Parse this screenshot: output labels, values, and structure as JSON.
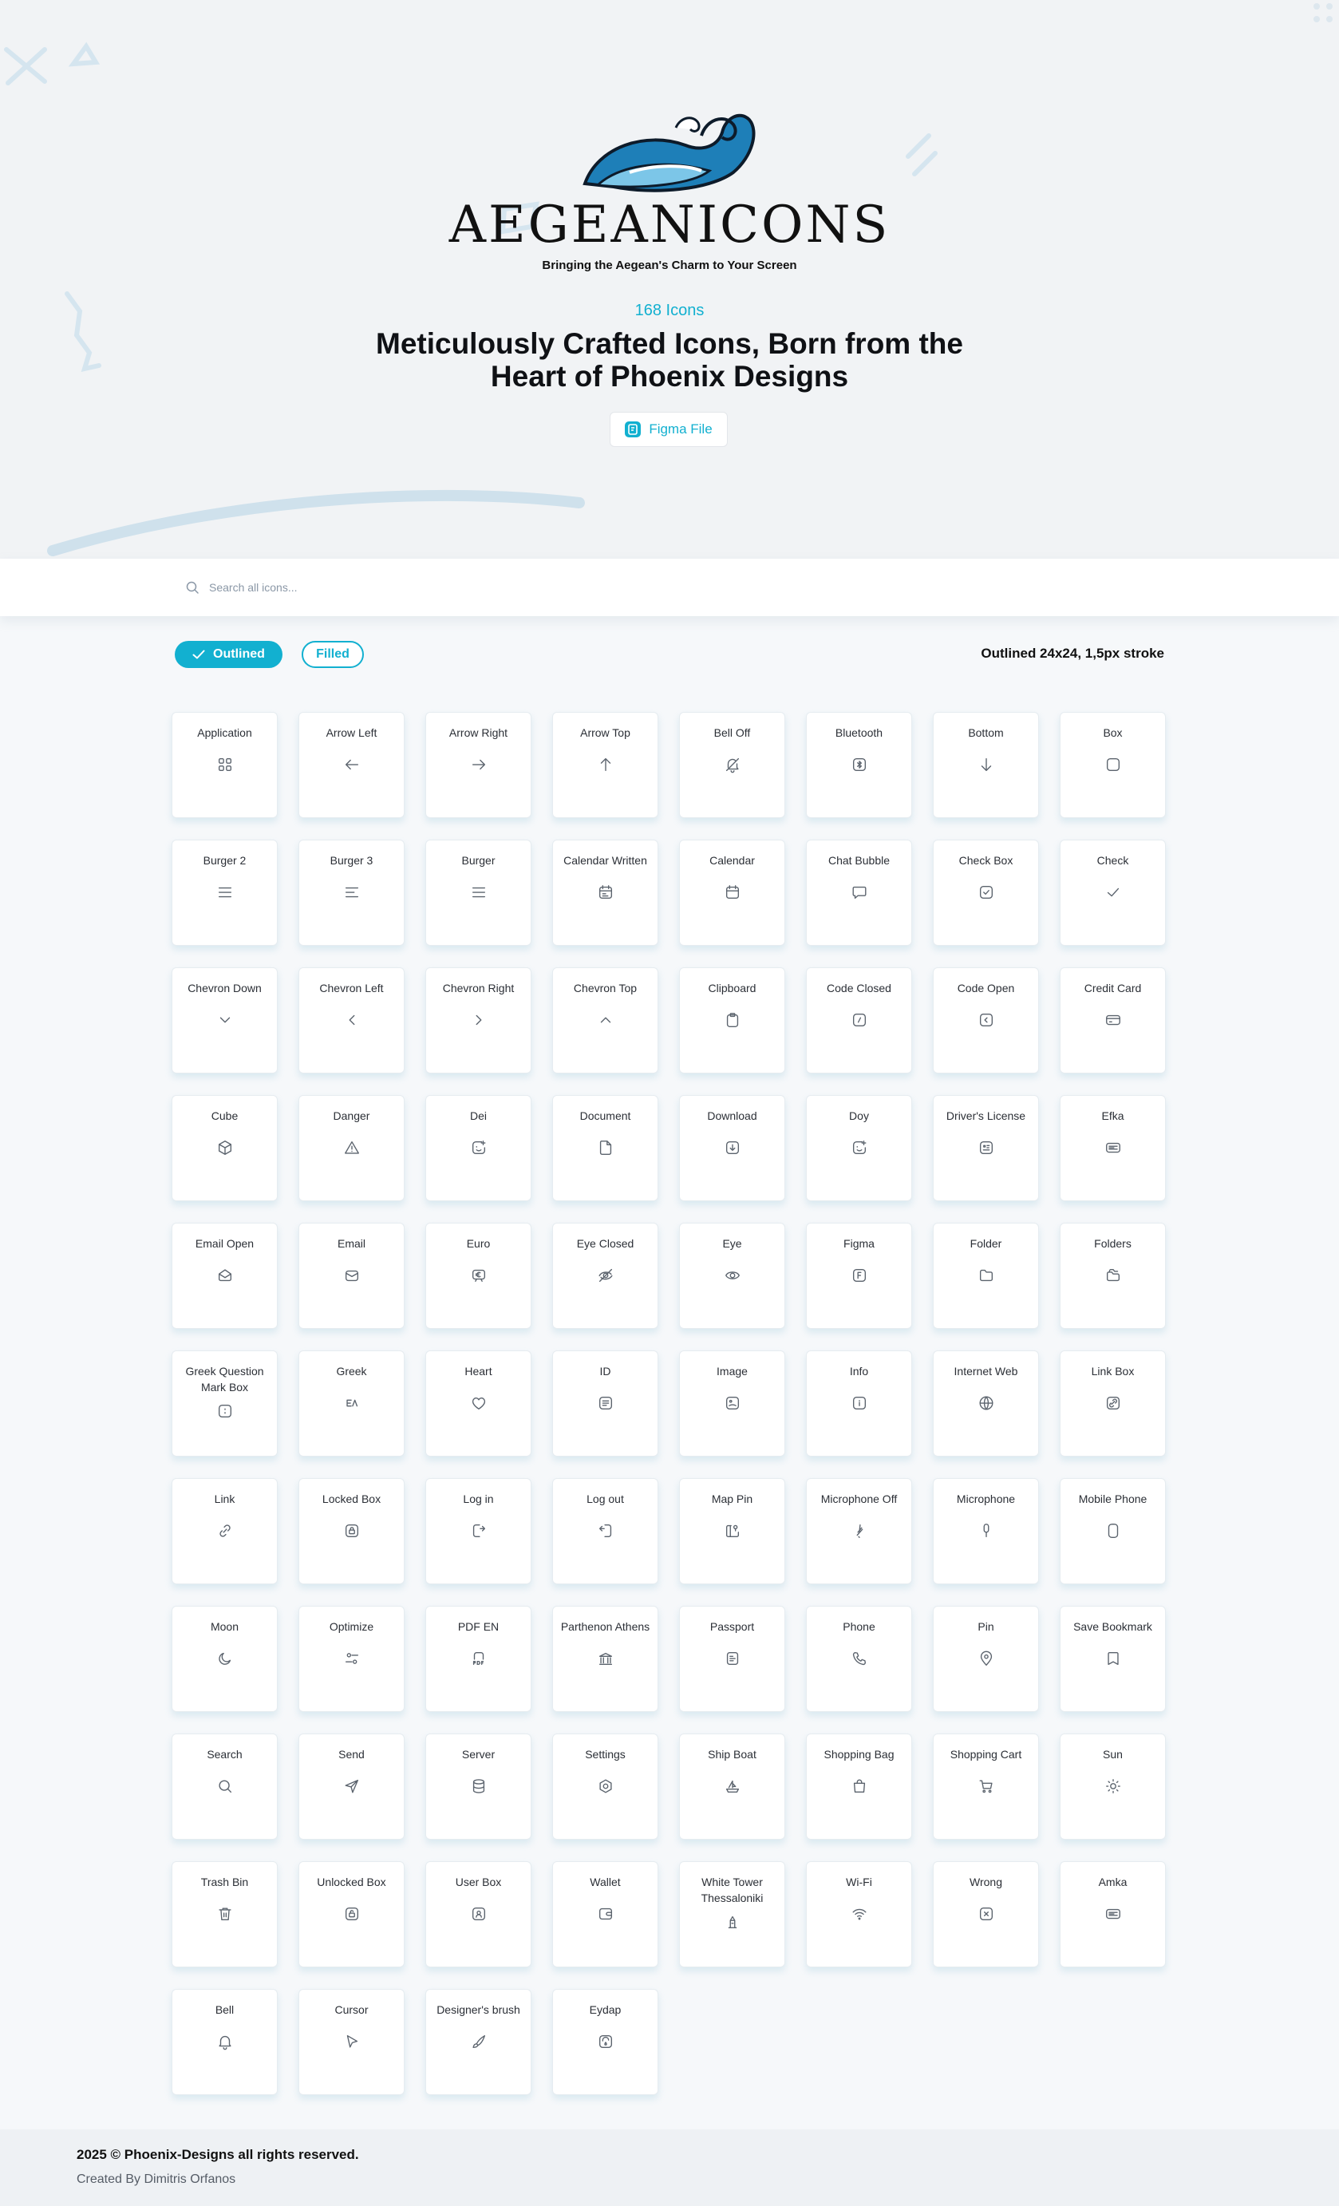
{
  "colors": {
    "accent": "#12b0d0",
    "text": "#111111",
    "background": "#f6f8fa"
  },
  "header": {
    "brand": "AEGEANICONS",
    "tagline": "Bringing the Aegean's Charm to Your Screen",
    "icon_count": "168 Icons",
    "headline_line1": "Meticulously Crafted Icons, Born from the",
    "headline_line2": "Heart of Phoenix Designs",
    "figma_button": "Figma File"
  },
  "search": {
    "placeholder": "Search all icons..."
  },
  "filters": {
    "outlined": "Outlined",
    "filled": "Filled",
    "active": "outlined",
    "spec": "Outlined 24x24, 1,5px stroke"
  },
  "icons": [
    {
      "name": "Application",
      "icon": "grid"
    },
    {
      "name": "Arrow Left",
      "icon": "arrow-left"
    },
    {
      "name": "Arrow Right",
      "icon": "arrow-right"
    },
    {
      "name": "Arrow Top",
      "icon": "arrow-up"
    },
    {
      "name": "Bell Off",
      "icon": "bell-off"
    },
    {
      "name": "Bluetooth",
      "icon": "bluetooth"
    },
    {
      "name": "Bottom",
      "icon": "arrow-down"
    },
    {
      "name": "Box",
      "icon": "box"
    },
    {
      "name": "Burger 2",
      "icon": "burger"
    },
    {
      "name": "Burger 3",
      "icon": "burger-short"
    },
    {
      "name": "Burger",
      "icon": "burger"
    },
    {
      "name": "Calendar Written",
      "icon": "calendar-written"
    },
    {
      "name": "Calendar",
      "icon": "calendar"
    },
    {
      "name": "Chat Bubble",
      "icon": "chat"
    },
    {
      "name": "Check Box",
      "icon": "checkbox"
    },
    {
      "name": "Check",
      "icon": "check"
    },
    {
      "name": "Chevron Down",
      "icon": "chevron-down"
    },
    {
      "name": "Chevron Left",
      "icon": "chevron-left"
    },
    {
      "name": "Chevron Right",
      "icon": "chevron-right"
    },
    {
      "name": "Chevron Top",
      "icon": "chevron-up"
    },
    {
      "name": "Clipboard",
      "icon": "clipboard"
    },
    {
      "name": "Code Closed",
      "icon": "code-closed"
    },
    {
      "name": "Code Open",
      "icon": "code-open"
    },
    {
      "name": "Credit Card",
      "icon": "credit-card"
    },
    {
      "name": "Cube",
      "icon": "cube"
    },
    {
      "name": "Danger",
      "icon": "danger"
    },
    {
      "name": "Dei",
      "icon": "face-plus"
    },
    {
      "name": "Document",
      "icon": "document"
    },
    {
      "name": "Download",
      "icon": "download"
    },
    {
      "name": "Doy",
      "icon": "face-plus"
    },
    {
      "name": "Driver's License",
      "icon": "license"
    },
    {
      "name": "Efka",
      "icon": "card-text"
    },
    {
      "name": "Email Open",
      "icon": "email-open"
    },
    {
      "name": "Email",
      "icon": "email"
    },
    {
      "name": "Euro",
      "icon": "euro"
    },
    {
      "name": "Eye Closed",
      "icon": "eye-closed"
    },
    {
      "name": "Eye",
      "icon": "eye"
    },
    {
      "name": "Figma",
      "icon": "figma"
    },
    {
      "name": "Folder",
      "icon": "folder"
    },
    {
      "name": "Folders",
      "icon": "folders"
    },
    {
      "name": "Greek Question Mark Box",
      "icon": "qmark-box"
    },
    {
      "name": "Greek",
      "icon": "greek"
    },
    {
      "name": "Heart",
      "icon": "heart"
    },
    {
      "name": "ID",
      "icon": "id"
    },
    {
      "name": "Image",
      "icon": "image"
    },
    {
      "name": "Info",
      "icon": "info"
    },
    {
      "name": "Internet Web",
      "icon": "globe"
    },
    {
      "name": "Link Box",
      "icon": "link-box"
    },
    {
      "name": "Link",
      "icon": "link"
    },
    {
      "name": "Locked Box",
      "icon": "locked-box"
    },
    {
      "name": "Log in",
      "icon": "log-in"
    },
    {
      "name": "Log out",
      "icon": "log-out"
    },
    {
      "name": "Map Pin",
      "icon": "map-pin"
    },
    {
      "name": "Microphone Off",
      "icon": "mic-off"
    },
    {
      "name": "Microphone",
      "icon": "mic"
    },
    {
      "name": "Mobile Phone",
      "icon": "mobile"
    },
    {
      "name": "Moon",
      "icon": "moon"
    },
    {
      "name": "Optimize",
      "icon": "optimize"
    },
    {
      "name": "PDF EN",
      "icon": "pdf"
    },
    {
      "name": "Parthenon Athens",
      "icon": "parthenon"
    },
    {
      "name": "Passport",
      "icon": "passport"
    },
    {
      "name": "Phone",
      "icon": "phone"
    },
    {
      "name": "Pin",
      "icon": "pin"
    },
    {
      "name": "Save Bookmark",
      "icon": "bookmark"
    },
    {
      "name": "Search",
      "icon": "search"
    },
    {
      "name": "Send",
      "icon": "send"
    },
    {
      "name": "Server",
      "icon": "server"
    },
    {
      "name": "Settings",
      "icon": "settings"
    },
    {
      "name": "Ship Boat",
      "icon": "ship"
    },
    {
      "name": "Shopping Bag",
      "icon": "bag"
    },
    {
      "name": "Shopping Cart",
      "icon": "cart"
    },
    {
      "name": "Sun",
      "icon": "sun"
    },
    {
      "name": "Trash Bin",
      "icon": "trash"
    },
    {
      "name": "Unlocked Box",
      "icon": "unlocked-box"
    },
    {
      "name": "User Box",
      "icon": "user-box"
    },
    {
      "name": "Wallet",
      "icon": "wallet"
    },
    {
      "name": "White Tower Thessaloniki",
      "icon": "tower"
    },
    {
      "name": "Wi-Fi",
      "icon": "wifi"
    },
    {
      "name": "Wrong",
      "icon": "wrong"
    },
    {
      "name": "Amka",
      "icon": "card-text"
    },
    {
      "name": "Bell",
      "icon": "bell"
    },
    {
      "name": "Cursor",
      "icon": "cursor"
    },
    {
      "name": "Designer's brush",
      "icon": "brush"
    },
    {
      "name": "Eydap",
      "icon": "eydap"
    }
  ],
  "footer": {
    "copyright": "2025 © Phoenix-Designs all rights reserved.",
    "credit": "Created By Dimitris Orfanos"
  }
}
